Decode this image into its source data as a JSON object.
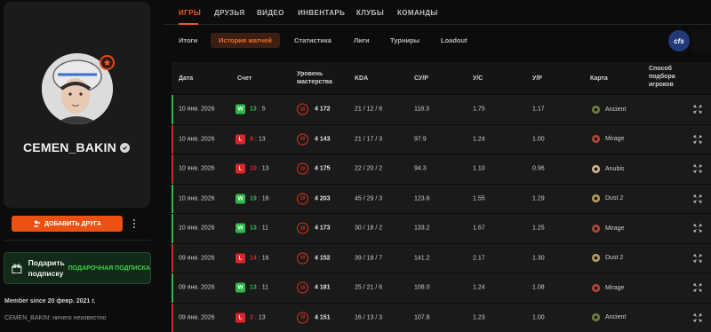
{
  "profile": {
    "username": "CEMEN_BAKIN",
    "add_friend_label": "ДОБАВИТЬ ДРУГА",
    "gift": {
      "title": "Подарить подписку",
      "tag": "ПОДАРОЧНАЯ ПОДПИСКА"
    },
    "member_since": "Member since 20 февр. 2021 г.",
    "status": "CEMEN_BAKIN: ничего неизвестно"
  },
  "topnav": {
    "items": [
      "ИГРЫ",
      "ДРУЗЬЯ",
      "ВИДЕО",
      "ИНВЕНТАРЬ",
      "КЛУБЫ",
      "КОМАНДЫ"
    ],
    "active": "ИГРЫ"
  },
  "subtabs": {
    "items": [
      "Итоги",
      "История матчей",
      "Статистика",
      "Лиги",
      "Турниры",
      "Loadout"
    ],
    "active": "История матчей"
  },
  "game_logo": "cfs",
  "colors": {
    "accent": "#ef5b1e",
    "win": "#2fb94a",
    "loss": "#d8262b",
    "gift": "#3fd24d"
  },
  "table": {
    "headers": {
      "date": "Дата",
      "score": "Счет",
      "mastery": "Уровень мастерства",
      "kda": "KDA",
      "adr": "СУ/Р",
      "ud": "У/С",
      "kr": "У/Р",
      "map": "Карта",
      "mode": "Способ подбора игроков"
    },
    "rows": [
      {
        "date": "10 янв. 2026",
        "result": "W",
        "score_a": "13",
        "score_b": "5",
        "elo": "4 172",
        "kda": "21 / 12 / 6",
        "adr": "118.3",
        "ud": "1.75",
        "kr": "1.17",
        "map": "Ancient"
      },
      {
        "date": "10 янв. 2026",
        "result": "L",
        "score_a": "8",
        "score_b": "13",
        "elo": "4 143",
        "kda": "21 / 17 / 3",
        "adr": "97.9",
        "ud": "1.24",
        "kr": "1.00",
        "map": "Mirage"
      },
      {
        "date": "10 янв. 2026",
        "result": "L",
        "score_a": "10",
        "score_b": "13",
        "elo": "4 175",
        "kda": "22 / 20 / 2",
        "adr": "94.3",
        "ud": "1.10",
        "kr": "0.96",
        "map": "Anubis"
      },
      {
        "date": "10 янв. 2026",
        "result": "W",
        "score_a": "19",
        "score_b": "16",
        "elo": "4 203",
        "kda": "45 / 29 / 3",
        "adr": "123.6",
        "ud": "1.55",
        "kr": "1.29",
        "map": "Dust 2"
      },
      {
        "date": "10 янв. 2026",
        "result": "W",
        "score_a": "13",
        "score_b": "11",
        "elo": "4 173",
        "kda": "30 / 18 / 2",
        "adr": "133.2",
        "ud": "1.67",
        "kr": "1.25",
        "map": "Mirage"
      },
      {
        "date": "09 янв. 2026",
        "result": "L",
        "score_a": "14",
        "score_b": "16",
        "elo": "4 152",
        "kda": "39 / 18 / 7",
        "adr": "141.2",
        "ud": "2.17",
        "kr": "1.30",
        "map": "Dust 2"
      },
      {
        "date": "09 янв. 2026",
        "result": "W",
        "score_a": "13",
        "score_b": "11",
        "elo": "4 181",
        "kda": "25 / 21 / 6",
        "adr": "108.0",
        "ud": "1.24",
        "kr": "1.08",
        "map": "Mirage"
      },
      {
        "date": "09 янв. 2026",
        "result": "L",
        "score_a": "3",
        "score_b": "13",
        "elo": "4 151",
        "kda": "16 / 13 / 3",
        "adr": "107.8",
        "ud": "1.23",
        "kr": "1.00",
        "map": "Ancient"
      }
    ]
  }
}
